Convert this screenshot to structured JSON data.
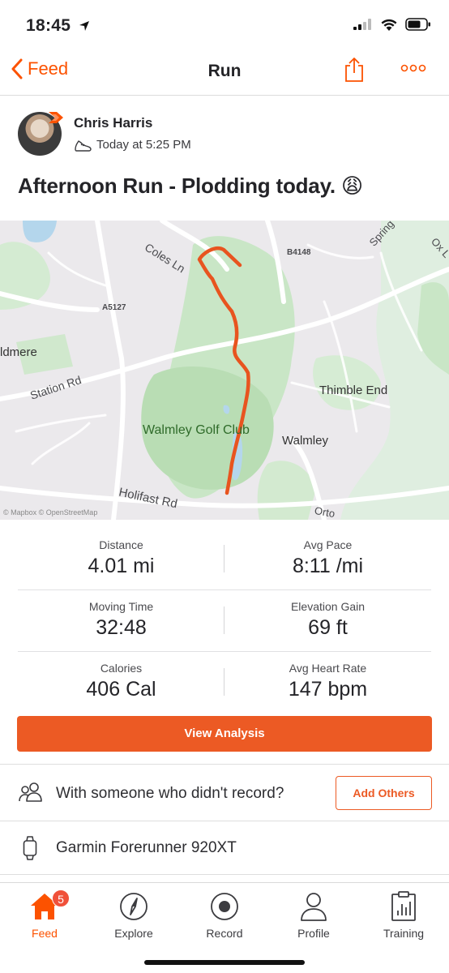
{
  "status": {
    "time": "18:45"
  },
  "nav": {
    "back_label": "Feed",
    "title": "Run"
  },
  "athlete": {
    "name": "Chris Harris",
    "timestamp": "Today at 5:25 PM"
  },
  "activity": {
    "title": "Afternoon Run - Plodding today. 😩"
  },
  "map": {
    "labels": {
      "coles_ln": "Coles Ln",
      "b4148": "B4148",
      "springfield": "Spring",
      "ox_lane": "Ox L",
      "a5127": "A5127",
      "idmere": "ldmere",
      "station_rd": "Station Rd",
      "thimble_end": "Thimble End",
      "walmley_golf_club": "Walmley Golf Club",
      "walmley": "Walmley",
      "holifast_rd": "Holifast Rd",
      "orto": "Orto"
    },
    "credit": "© Mapbox © OpenStreetMap"
  },
  "stats": [
    {
      "left": {
        "label": "Distance",
        "value": "4.01 mi"
      },
      "right": {
        "label": "Avg Pace",
        "value": "8:11 /mi"
      }
    },
    {
      "left": {
        "label": "Moving Time",
        "value": "32:48"
      },
      "right": {
        "label": "Elevation Gain",
        "value": "69 ft"
      }
    },
    {
      "left": {
        "label": "Calories",
        "value": "406 Cal"
      },
      "right": {
        "label": "Avg Heart Rate",
        "value": "147 bpm"
      }
    }
  ],
  "actions": {
    "view_analysis": "View Analysis",
    "add_others": "Add Others"
  },
  "with_row": {
    "text": "With someone who didn't record?",
    "icon": "group-icon"
  },
  "device": {
    "text": "Garmin Forerunner 920XT",
    "icon": "watch-icon"
  },
  "tabs": [
    {
      "label": "Feed",
      "icon": "home-icon",
      "badge": "5",
      "active": true
    },
    {
      "label": "Explore",
      "icon": "compass-icon"
    },
    {
      "label": "Record",
      "icon": "record-icon"
    },
    {
      "label": "Profile",
      "icon": "person-icon"
    },
    {
      "label": "Training",
      "icon": "clipboard-chart-icon"
    }
  ],
  "colors": {
    "brand": "#fc5200",
    "button": "#ec5a24",
    "route": "#e8541f"
  }
}
